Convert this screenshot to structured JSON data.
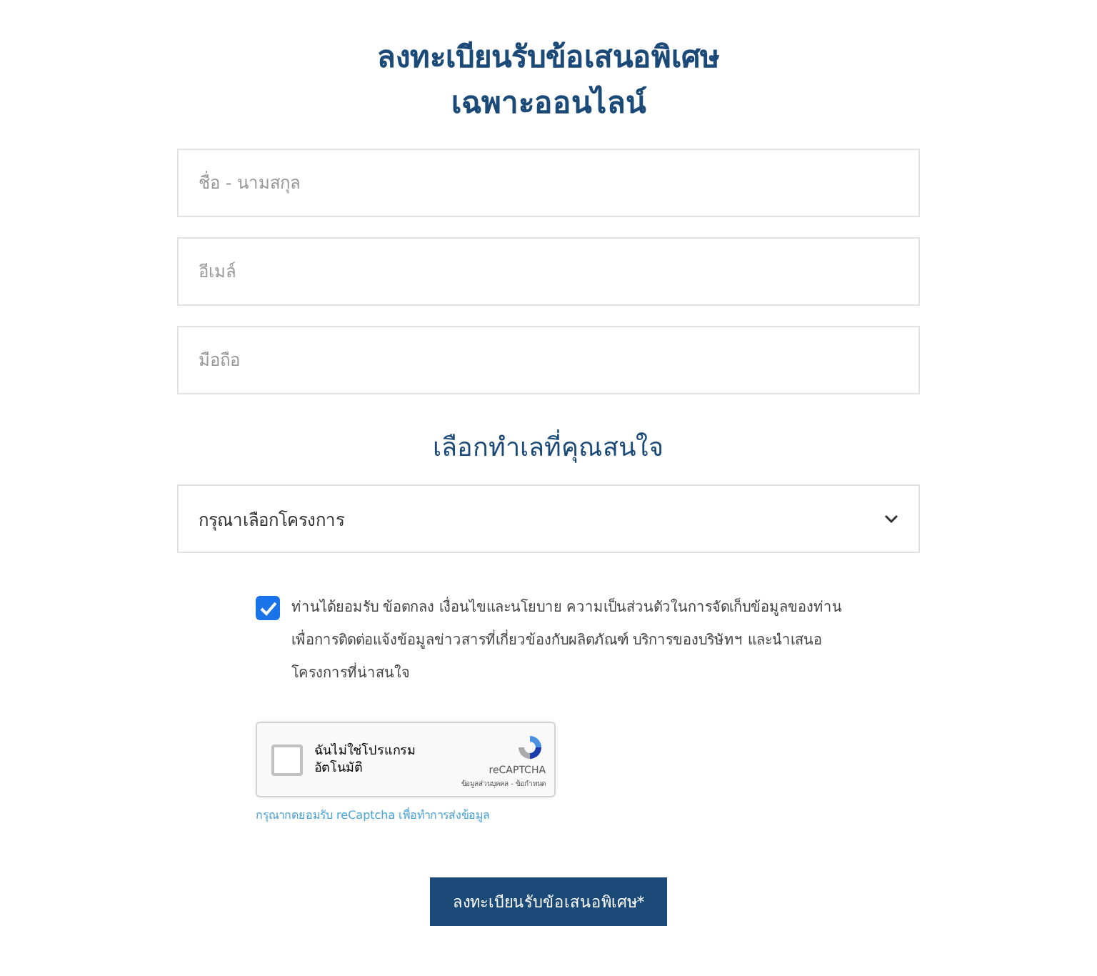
{
  "title_lines": [
    "ลงทะเบียนรับข้อเสนอพิเศษ",
    "เฉพาะออนไลน์"
  ],
  "fields": [
    {
      "placeholder": "ชื่อ - นามสกุล"
    },
    {
      "placeholder": "อีเมล์"
    },
    {
      "placeholder": "มือถือ"
    }
  ],
  "project_heading": "เลือกทำเลที่คุณสนใจ",
  "project_select": {
    "placeholder": "กรุณาเลือกโครงการ"
  },
  "consent": {
    "checked": true,
    "lines": [
      "ท่านได้ยอมรับ ข้อตกลง เงื่อนไขและนโยบาย ความเป็นส่วนตัวในการจัดเก็บข้อมูลของท่าน",
      "เพื่อการติดต่อแจ้งข้อมูลข่าวสารที่เกี่ยวข้องกับผลิตภัณฑ์ บริการของบริษัทฯ และนำเสนอ",
      "โครงการที่น่าสนใจ"
    ]
  },
  "captcha": {
    "checked": false,
    "label_lines": [
      "ฉันไม่ใช่โปรแกรม",
      "อัตโนมัติ"
    ],
    "brand": "reCAPTCHA",
    "links": "ข้อมูลส่วนบุคคล - ข้อกำหนด"
  },
  "captcha_hint": "กรุณากดยอมรับ reCaptcha เพื่อทำการส่งข้อมูล",
  "submit": "ลงทะเบียนรับข้อเสนอพิเศษ*"
}
